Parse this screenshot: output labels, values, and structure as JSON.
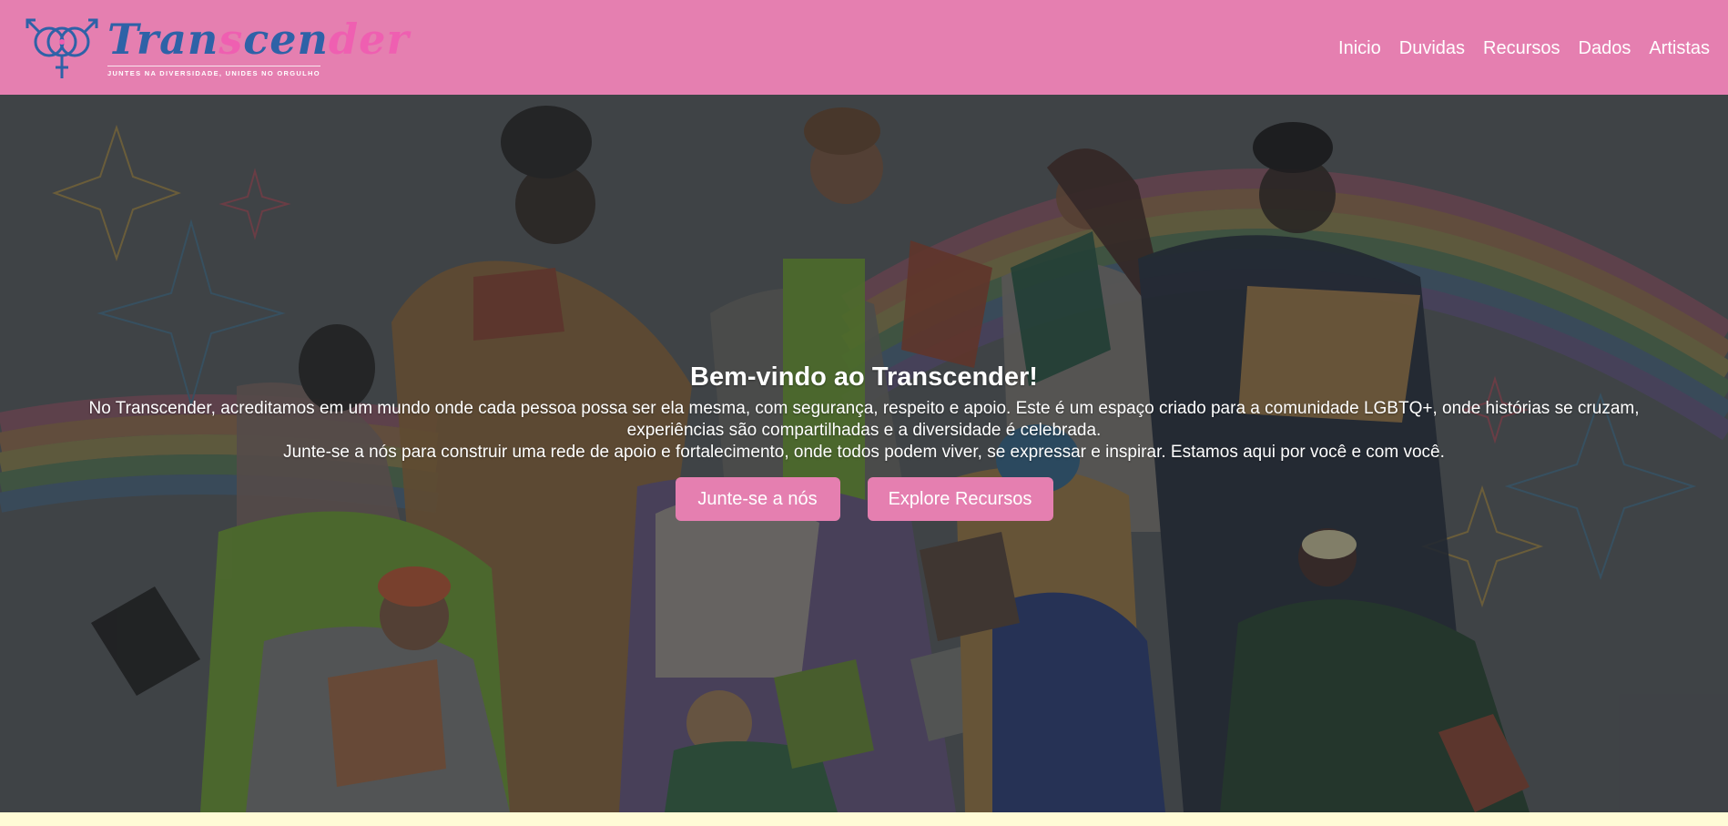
{
  "brand": {
    "name_part1": "Tran",
    "name_part2": "s",
    "name_part3": "cen",
    "name_part4": "der",
    "tagline": "Juntes na diversidade, unides no orgulho"
  },
  "nav": {
    "items": [
      {
        "label": "Inicio"
      },
      {
        "label": "Duvidas"
      },
      {
        "label": "Recursos"
      },
      {
        "label": "Dados"
      },
      {
        "label": "Artistas"
      }
    ]
  },
  "hero": {
    "title": "Bem-vindo ao Transcender!",
    "paragraph_line1": "No Transcender, acreditamos em um mundo onde cada pessoa possa ser ela mesma, com segurança, respeito e apoio. Este é um espaço criado para a comunidade LGBTQ+, onde histórias se cruzam,",
    "paragraph_line2": "experiências são compartilhadas e a diversidade é celebrada.",
    "paragraph_line3": "Junte-se a nós para construir uma rede de apoio e fortalecimento, onde todos podem viver, se expressar e inspirar. Estamos aqui por você e com você.",
    "button_join": "Junte-se a nós",
    "button_explore": "Explore Recursos"
  },
  "colors": {
    "navbar": "#e57fb0",
    "button": "#e57fb0",
    "logo_blue": "#2e62a7",
    "logo_pink": "#ef5fb1",
    "footer_strip": "#fffbd6"
  },
  "icons": {
    "logo_symbol": "transgender-symbol-icon"
  }
}
